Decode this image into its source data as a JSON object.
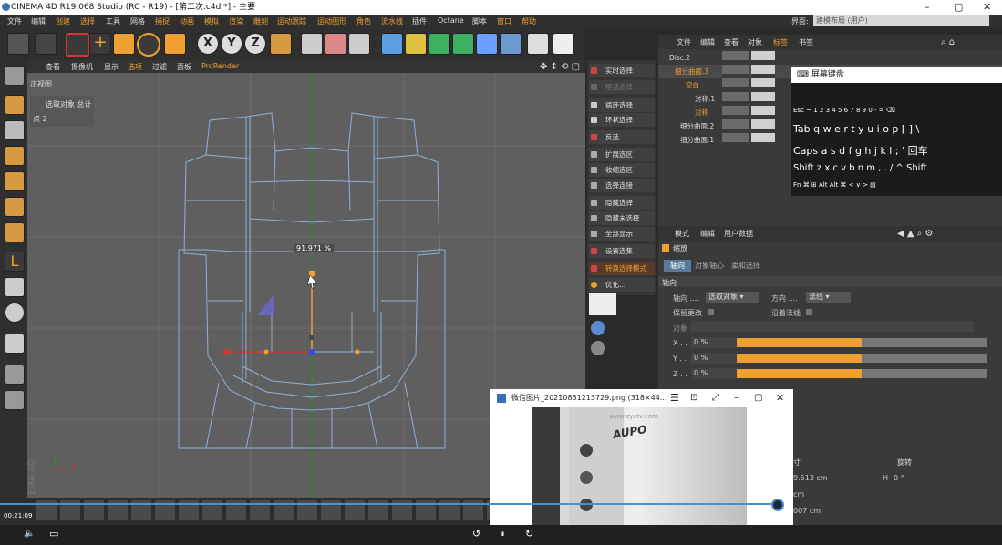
{
  "window": {
    "title": "CINEMA 4D R19.068 Studio (RC - R19) - [第二次.c4d *] - 主要",
    "buttons": {
      "minimize": "–",
      "maximize": "▢",
      "close": "✕"
    }
  },
  "menubar": {
    "items": [
      "文件",
      "编辑",
      "创建",
      "选择",
      "工具",
      "网格",
      "捕捉",
      "动画",
      "模拟",
      "渲染",
      "雕刻",
      "运动跟踪",
      "运动图形",
      "角色",
      "流水线",
      "插件",
      "Octane",
      "脚本",
      "窗口",
      "帮助"
    ],
    "layout_label": "界面:",
    "layout_value": "建模布局 (用户)"
  },
  "viewport": {
    "menu": [
      "查看",
      "摄像机",
      "显示",
      "选项",
      "过滤",
      "面板",
      "ProRender"
    ],
    "view_name": "正视图",
    "hud_label": "选取对象 总计",
    "hud_points": "点  2",
    "percent_label": "91.971 %",
    "axis_y": "Y",
    "axis_x": "X",
    "frame": "00:21:09"
  },
  "selection_menu": [
    {
      "label": "实时选择",
      "dim": false
    },
    {
      "label": "框选选择",
      "dim": true
    },
    {
      "label": "循环选择",
      "dim": false
    },
    {
      "label": "环状选择",
      "dim": false
    },
    {
      "label": "反选",
      "dim": false
    },
    {
      "label": "扩展选区",
      "dim": false
    },
    {
      "label": "收缩选区",
      "dim": false
    },
    {
      "label": "选择连接",
      "dim": false
    },
    {
      "label": "隐藏选择",
      "dim": false
    },
    {
      "label": "隐藏未选择",
      "dim": false
    },
    {
      "label": "全部显示",
      "dim": false
    },
    {
      "label": "设置选集",
      "dim": false
    },
    {
      "label": "转换选择模式",
      "dim": false,
      "highlight": true
    },
    {
      "label": "优化...",
      "dim": false
    }
  ],
  "object_manager": {
    "menu": [
      "文件",
      "编辑",
      "查看",
      "对象",
      "标签",
      "书签"
    ],
    "objects": [
      {
        "name": "Disc.2",
        "level": 0,
        "color": "#dcdcdc"
      },
      {
        "name": "细分曲面.3",
        "level": 0,
        "color": "#f0a030"
      },
      {
        "name": "空白",
        "level": 1,
        "color": "#f0a030"
      },
      {
        "name": "对称.1",
        "level": 2,
        "color": "#dcdcdc"
      },
      {
        "name": "对称",
        "level": 2,
        "color": "#f0a030"
      },
      {
        "name": "细分曲面.2",
        "level": 0,
        "color": "#dcdcdc"
      },
      {
        "name": "细分曲面.1",
        "level": 0,
        "color": "#dcdcdc"
      }
    ]
  },
  "keyboard": {
    "title": "屏幕键盘",
    "rows": [
      "Esc ~ 1 2 3 4 5 6 7 8 9 0 - = ⌫",
      "Tab q w e r t y u i o p [ ] \\",
      "Caps a s d f g h j k l ; ' 回车",
      "Shift z x c v b n m , . / ^ Shift",
      "Fn ⌘ ⊞ Alt            Alt ⌘ < ∨ > ▤"
    ]
  },
  "attributes": {
    "menu": [
      "模式",
      "编辑",
      "用户数据"
    ],
    "title": "缩放",
    "tabs": [
      "轴向",
      "对象轴心",
      "柔和选择"
    ],
    "section": "轴向",
    "axis_label": "轴向 ....",
    "axis_value": "选取对象",
    "direction_label": "方向 ....",
    "direction_value": "法线",
    "keep_label": "保留更改",
    "normal_label": "沿着法线",
    "object_label": "对象",
    "x_label": "X . .",
    "y_label": "Y . .",
    "z_label": "Z . .",
    "x_value": "0 %",
    "y_value": "0 %",
    "z_value": "0 %",
    "slider_fill": 0.5
  },
  "coords": {
    "size_header": "寸",
    "rot_header": "旋转",
    "v1": "9.513 cm",
    "h_label": "H",
    "h_value": "0 °",
    "v2": "cm",
    "v3": "007 cm"
  },
  "image_viewer": {
    "title": "微信图片_20210831213729.png  (318×44...",
    "watermark": "www.zyctv.com",
    "brand": "AUPO"
  },
  "colors": {
    "accent": "#f0a030",
    "blue_line": "#4a8fd0"
  }
}
